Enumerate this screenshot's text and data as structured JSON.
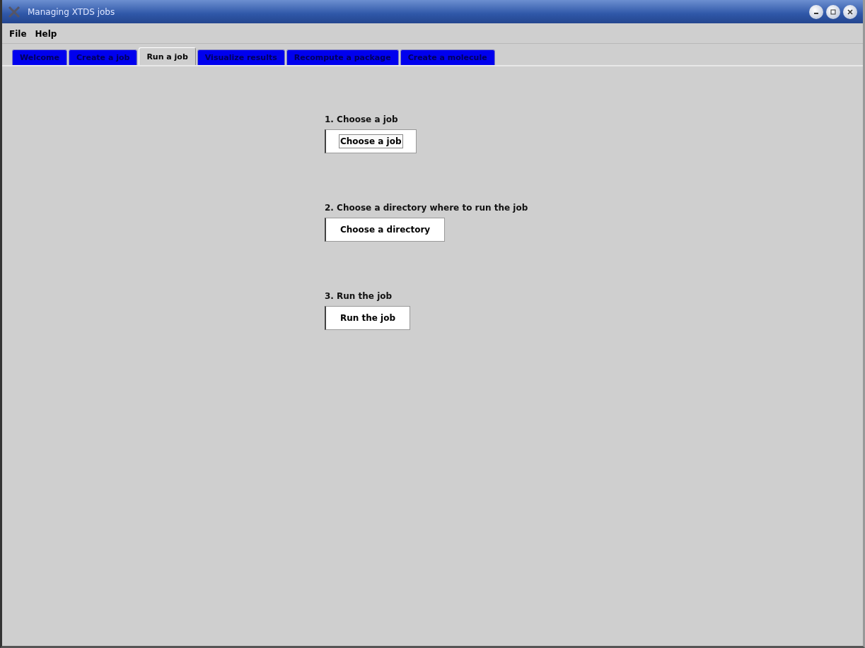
{
  "window": {
    "title": "Managing XTDS jobs"
  },
  "menu": [
    "File",
    "Help"
  ],
  "tabs": [
    {
      "label": "Welcome",
      "selected": false
    },
    {
      "label": "Create a job",
      "selected": false
    },
    {
      "label": "Run a job",
      "selected": true
    },
    {
      "label": "Visualize results",
      "selected": false
    },
    {
      "label": "Recompute a package",
      "selected": false
    },
    {
      "label": "Create a molecule",
      "selected": false
    }
  ],
  "steps": [
    {
      "label": "1. Choose a job",
      "button": "Choose a job",
      "focused": true
    },
    {
      "label": "2. Choose a directory where to run the job",
      "button": "Choose a directory",
      "focused": false
    },
    {
      "label": "3. Run the job",
      "button": "Run the job",
      "focused": false
    }
  ]
}
